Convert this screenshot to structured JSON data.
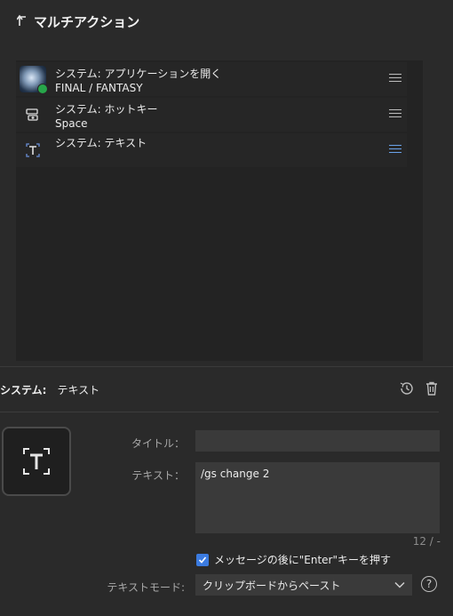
{
  "header": {
    "title": "マルチアクション",
    "back_icon": "back-arrow-icon"
  },
  "actions": [
    {
      "name": "システム: アプリケーションを開く",
      "sub": "FINAL / FANTASY",
      "icon": "game-thumbnail"
    },
    {
      "name": "システム: ホットキー",
      "sub": "Space",
      "icon": "hotkey-icon"
    },
    {
      "name": "システム: テキスト",
      "sub": "",
      "icon": "text-icon"
    }
  ],
  "detail": {
    "label": "システム:",
    "value": "テキスト",
    "title_label": "タイトル：",
    "title_value": "",
    "text_label": "テキスト：",
    "text_value": "/gs change 2",
    "counter": "12 / -",
    "enter_checkbox_label": "メッセージの後に\"Enter\"キーを押す",
    "enter_checked": true,
    "mode_label": "テキストモード:",
    "mode_value": "クリップボードからペースト",
    "help_glyph": "?"
  },
  "colors": {
    "background": "#2a2a2a",
    "panel": "#232323",
    "accent": "#3b7be0",
    "input": "#3a3a3a"
  }
}
